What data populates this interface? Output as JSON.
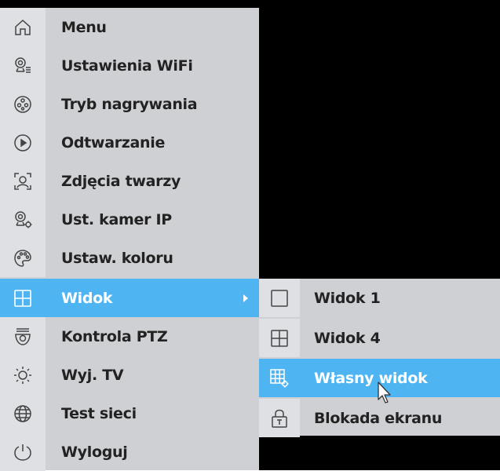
{
  "colors": {
    "menu_bg": "#cfd0d4",
    "icon_cell_bg": "#dfe0e3",
    "active_bg": "#4fb5f2",
    "screen_bg": "#000000",
    "text": "#222222",
    "active_text": "#ffffff"
  },
  "main_menu": {
    "items": [
      {
        "label": "Menu",
        "icon": "home-icon"
      },
      {
        "label": "Ustawienia WiFi",
        "icon": "wifi-camera-settings-icon"
      },
      {
        "label": "Tryb nagrywania",
        "icon": "record-mode-icon"
      },
      {
        "label": "Odtwarzanie",
        "icon": "play-icon"
      },
      {
        "label": "Zdjęcia twarzy",
        "icon": "face-capture-icon"
      },
      {
        "label": "Ust. kamer IP",
        "icon": "ip-camera-settings-icon"
      },
      {
        "label": "Ustaw. koloru",
        "icon": "color-palette-icon"
      },
      {
        "label": "Widok",
        "icon": "grid-view-icon",
        "active": true,
        "has_submenu": true
      },
      {
        "label": "Kontrola PTZ",
        "icon": "ptz-camera-icon"
      },
      {
        "label": "Wyj. TV",
        "icon": "sun-brightness-icon"
      },
      {
        "label": "Test sieci",
        "icon": "globe-icon"
      },
      {
        "label": "Wyloguj",
        "icon": "power-icon"
      }
    ]
  },
  "submenu": {
    "items": [
      {
        "label": "Widok 1",
        "icon": "single-view-icon"
      },
      {
        "label": "Widok 4",
        "icon": "quad-view-icon"
      },
      {
        "label": "Własny widok",
        "icon": "custom-view-icon",
        "active": true
      },
      {
        "label": "Blokada ekranu",
        "icon": "lock-screen-icon"
      }
    ]
  }
}
